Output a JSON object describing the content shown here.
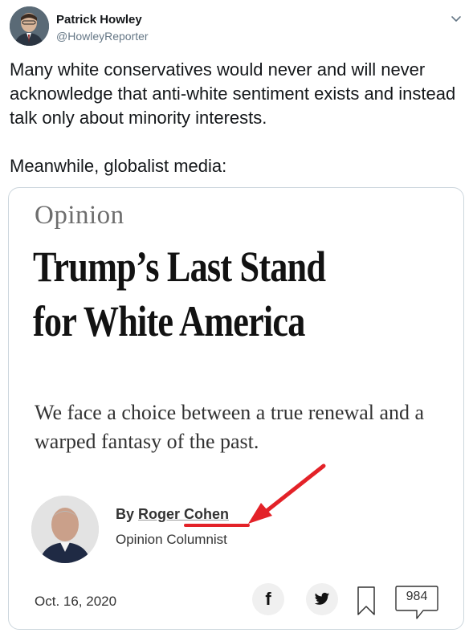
{
  "tweet": {
    "author_name": "Patrick Howley",
    "author_handle": "@HowleyReporter",
    "text_paragraph_1": "Many white conservatives would never and will never acknowledge that anti-white sentiment exists and instead talk only about minority interests.",
    "text_paragraph_2": "Meanwhile, globalist media:"
  },
  "card": {
    "section_label": "Opinion",
    "headline": "Trump’s Last Stand for White America",
    "deck": "We face a choice between a true renewal and a warped fantasy of the past.",
    "byline_prefix": "By ",
    "byline_author": "Roger Cohen",
    "author_role": "Opinion Columnist",
    "date": "Oct. 16, 2020",
    "comments_count": "984"
  },
  "icons": {
    "caret": "chevron-down-icon",
    "facebook": "facebook-icon",
    "twitter": "twitter-icon",
    "bookmark": "bookmark-icon",
    "comments": "comment-bubble-icon",
    "annotation_arrow": "arrow-icon"
  },
  "colors": {
    "annotation_red": "#e32228",
    "handle_gray": "#657786",
    "card_border": "#ccd6dd"
  }
}
